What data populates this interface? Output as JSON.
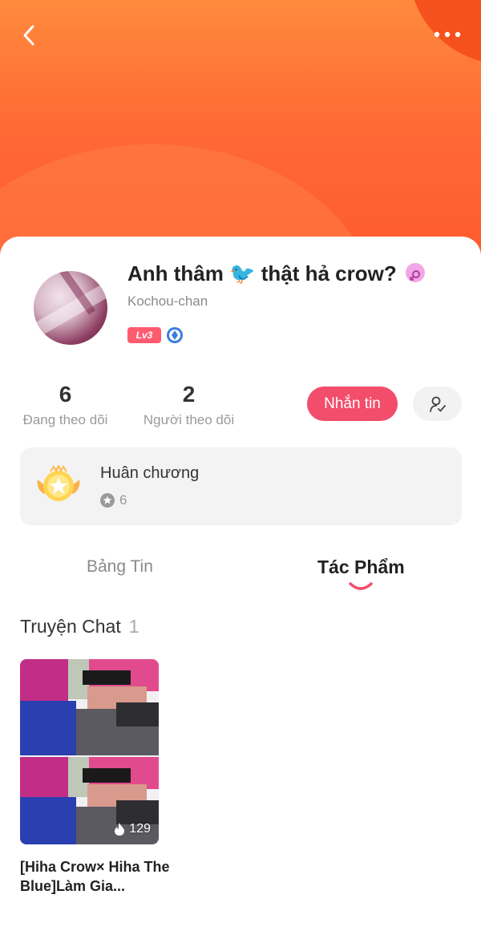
{
  "profile": {
    "name_prefix": "Anh thâm",
    "name_emoji": "🐦",
    "name_suffix": "thật hả crow?",
    "username": "Kochou-chan",
    "level": "Lv3",
    "gender": "female"
  },
  "stats": {
    "following_count": "6",
    "following_label": "Đang theo dõi",
    "followers_count": "2",
    "followers_label": "Người theo dõi"
  },
  "actions": {
    "message_label": "Nhắn tin"
  },
  "medals": {
    "title": "Huân chương",
    "count": "6"
  },
  "tabs": [
    {
      "label": "Bảng Tin",
      "active": false
    },
    {
      "label": "Tác Phẩm",
      "active": true
    }
  ],
  "section": {
    "title": "Truyện Chat",
    "count": "1"
  },
  "stories": [
    {
      "title": "[Hiha Crow× Hiha The Blue]Làm Gia...",
      "views": "129"
    }
  ],
  "colors": {
    "accent": "#f24d6b",
    "header_orange": "#ff6a35"
  }
}
